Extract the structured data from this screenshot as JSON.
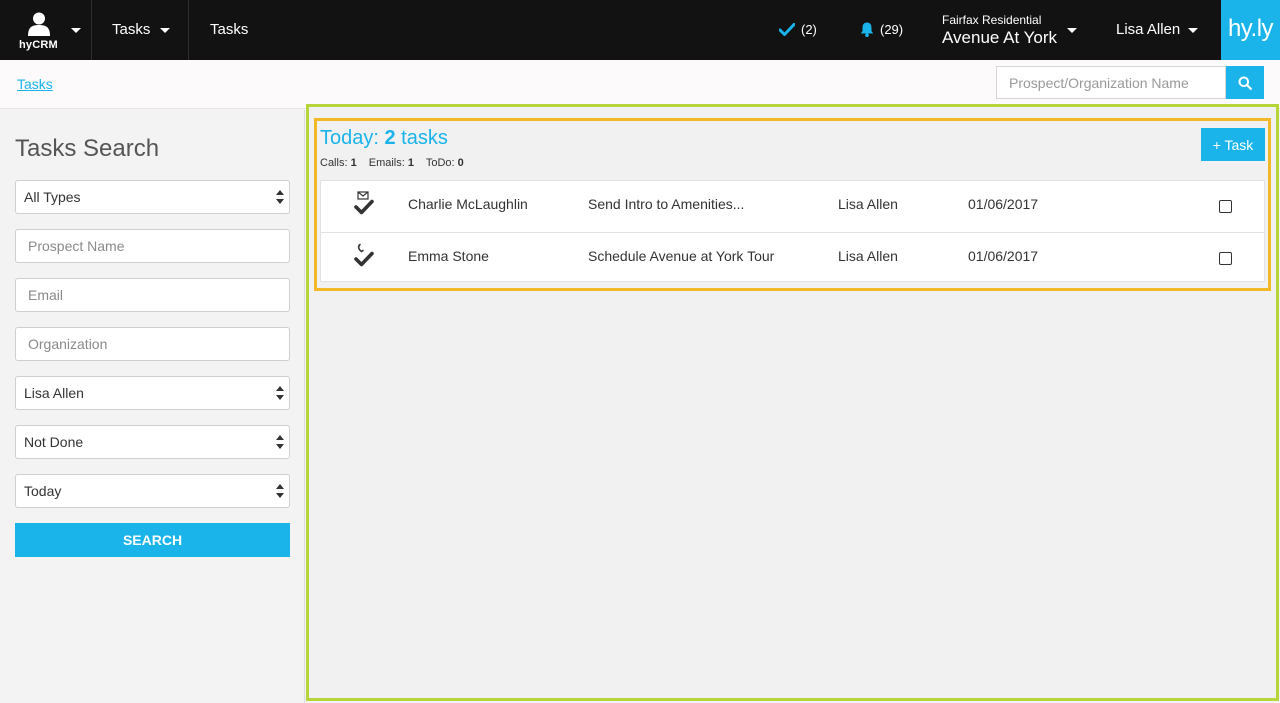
{
  "nav": {
    "brand_label": "hyCRM",
    "tasks_menu_label": "Tasks",
    "tasks_link_label": "Tasks",
    "tasks_count": "(2)",
    "notifications_count": "(29)",
    "property_org": "Fairfax Residential",
    "property_name": "Avenue At York",
    "user_name": "Lisa Allen",
    "logo_text": "hy.ly"
  },
  "breadcrumb": {
    "link": "Tasks"
  },
  "prospect_search": {
    "placeholder": "Prospect/Organization Name"
  },
  "sidebar": {
    "title": "Tasks Search",
    "type_select": "All Types",
    "prospect_placeholder": "Prospect Name",
    "email_placeholder": "Email",
    "organization_placeholder": "Organization",
    "owner_select": "Lisa Allen",
    "status_select": "Not Done",
    "date_select": "Today",
    "search_button": "SEARCH"
  },
  "today": {
    "heading_prefix": "Today: ",
    "count": "2",
    "heading_suffix": " tasks",
    "calls_label": "Calls: ",
    "calls_count": "1",
    "emails_label": "Emails: ",
    "emails_count": "1",
    "todo_label": "ToDo: ",
    "todo_count": "0",
    "add_task_button": "+ Task",
    "tasks": [
      {
        "type_icon": "email-task-icon",
        "name": "Charlie McLaughlin",
        "subject": "Send Intro to Amenities...",
        "owner": "Lisa Allen",
        "date": "01/06/2017"
      },
      {
        "type_icon": "call-task-icon",
        "name": "Emma Stone",
        "subject": "Schedule Avenue at York Tour",
        "owner": "Lisa Allen",
        "date": "01/06/2017"
      }
    ]
  },
  "colors": {
    "accent": "#1ab4ea",
    "nav_bg": "#121212",
    "outer_frame": "#b6d53b",
    "inner_frame": "#f2b825"
  }
}
